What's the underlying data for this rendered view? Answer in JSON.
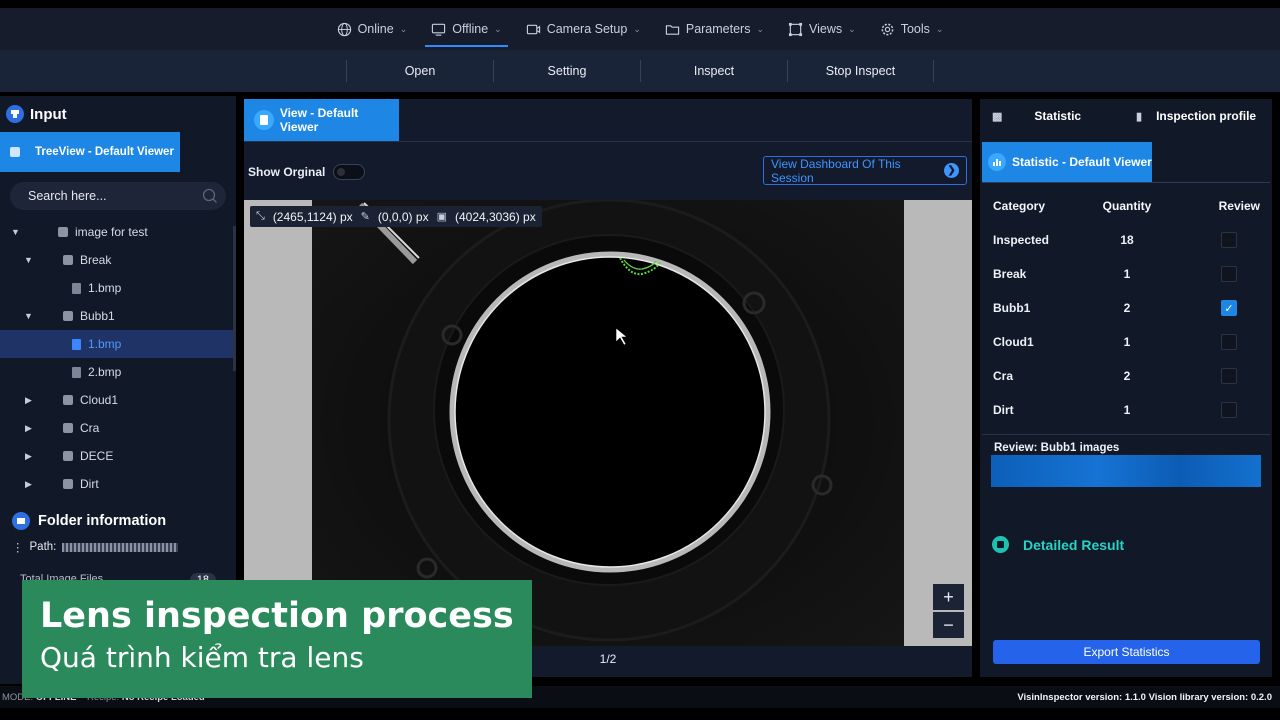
{
  "menu": {
    "items": [
      {
        "label": "Online",
        "icon": "globe-icon"
      },
      {
        "label": "Offline",
        "icon": "monitor-icon",
        "active": true
      },
      {
        "label": "Camera Setup",
        "icon": "camera-icon"
      },
      {
        "label": "Parameters",
        "icon": "folder-icon"
      },
      {
        "label": "Views",
        "icon": "views-icon"
      },
      {
        "label": "Tools",
        "icon": "gear-icon"
      }
    ]
  },
  "toolbar": {
    "buttons": [
      "Open",
      "Setting",
      "Inspect",
      "Stop Inspect"
    ]
  },
  "left_panel": {
    "title": "Input",
    "tab": "TreeView - Default Viewer",
    "search_placeholder": "Search here...",
    "tree": [
      {
        "label": "image for test",
        "type": "folder",
        "level": 1,
        "expanded": true
      },
      {
        "label": "Break",
        "type": "folder",
        "level": 2,
        "expanded": true
      },
      {
        "label": "1.bmp",
        "type": "file",
        "level": 3
      },
      {
        "label": "Bubb1",
        "type": "folder",
        "level": 2,
        "expanded": true
      },
      {
        "label": "1.bmp",
        "type": "file",
        "level": 3,
        "selected": true
      },
      {
        "label": "2.bmp",
        "type": "file",
        "level": 3
      },
      {
        "label": "Cloud1",
        "type": "folder",
        "level": 2,
        "expanded": false
      },
      {
        "label": "Cra",
        "type": "folder",
        "level": 2,
        "expanded": false
      },
      {
        "label": "DECE",
        "type": "folder",
        "level": 2,
        "expanded": false
      },
      {
        "label": "Dirt",
        "type": "folder",
        "level": 2,
        "expanded": false
      }
    ],
    "folder_info": {
      "title": "Folder information",
      "path_label": "Path:",
      "total_label": "Total Image Files",
      "total_count": "18"
    }
  },
  "viewer": {
    "tab": "View - Default Viewer",
    "show_original_label": "Show Orginal",
    "show_original": false,
    "dashboard_button": "View Dashboard Of This Session",
    "coords": {
      "position": "(2465,1124) px",
      "color": "(0,0,0) px",
      "size": "(4024,3036) px"
    },
    "pager": "1/2"
  },
  "right_panel": {
    "tabs": [
      "Statistic",
      "Inspection profile"
    ],
    "stat_tab": "Statistic - Default Viewer",
    "table": {
      "headers": [
        "Category",
        "Quantity",
        "Review"
      ],
      "rows": [
        {
          "category": "Inspected",
          "quantity": "18",
          "review": false
        },
        {
          "category": "Break",
          "quantity": "1",
          "review": false
        },
        {
          "category": "Bubb1",
          "quantity": "2",
          "review": true
        },
        {
          "category": "Cloud1",
          "quantity": "1",
          "review": false
        },
        {
          "category": "Cra",
          "quantity": "2",
          "review": false
        },
        {
          "category": "Dirt",
          "quantity": "1",
          "review": false
        }
      ]
    },
    "review_title": "Review: Bubb1 images",
    "detailed_result": "Detailed Result",
    "export_button": "Export Statistics"
  },
  "status_bar": {
    "mode_label": "MODE:",
    "mode_value": "OFFLINE",
    "recipe_label": "Recipe:",
    "recipe_value": "No Recipe Loaded",
    "version": "VisinInspector version: 1.1.0  Vision library version: 0.2.0"
  },
  "caption": {
    "title": "Lens inspection process",
    "subtitle": "Quá trình kiểm tra lens"
  },
  "colors": {
    "accent": "#1e87e5",
    "teal": "#27d3c2",
    "caption_bg": "#2b8a5c"
  }
}
